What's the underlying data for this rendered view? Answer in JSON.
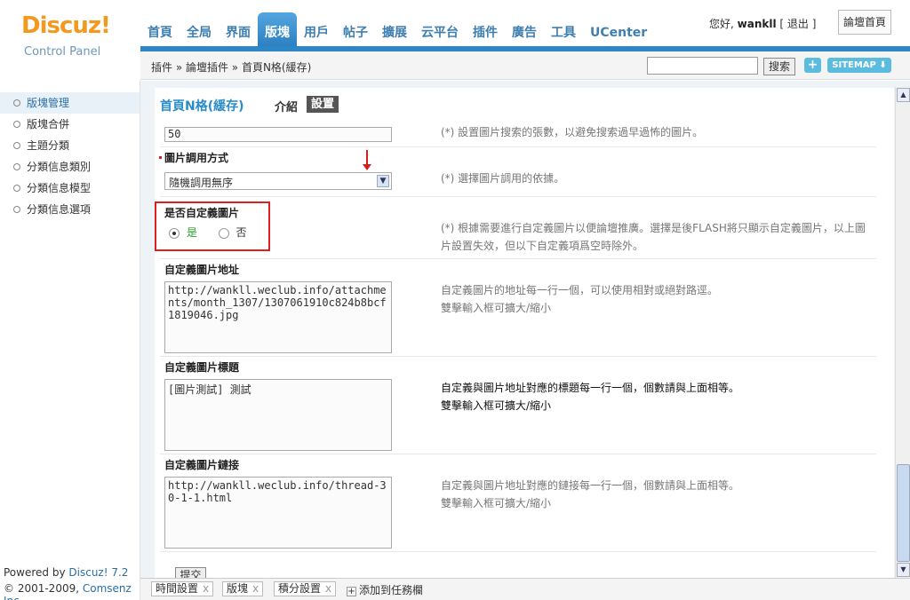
{
  "header": {
    "logo_brand": "Discuz!",
    "logo_sub": "Control Panel",
    "nav": [
      "首頁",
      "全局",
      "界面",
      "版塊",
      "用戶",
      "帖子",
      "擴展",
      "云平台",
      "插件",
      "廣告",
      "工具",
      "UCenter"
    ],
    "active_nav": "版塊",
    "greeting": "您好,",
    "username": "wankll",
    "logout": "[ 退出 ]",
    "forum_home": "論壇首頁"
  },
  "breadcrumb": "插件 » 論壇插件 » 首頁N格(緩存)",
  "search": {
    "button": "搜索",
    "placeholder": ""
  },
  "toolbar": {
    "plus": "+",
    "sitemap": "SITEMAP ⬇"
  },
  "sidebar": {
    "items": [
      "版塊管理",
      "版塊合併",
      "主題分類",
      "分類信息類別",
      "分類信息模型",
      "分類信息選項"
    ],
    "active": "版塊管理",
    "powered_prefix": "Powered by",
    "powered_link": "Discuz! 7.2",
    "copyright_prefix": "© 2001-2009,",
    "copyright_link": "Comsenz Inc."
  },
  "content": {
    "title": "首頁N格(緩存)",
    "tab_intro": "介紹",
    "tab_settings": "設置",
    "partial_value": "50",
    "partial_hint": "(*) 設置圖片搜索的張數，以避免搜索過早過怖的圖片。",
    "pic_method": {
      "label": "圖片調用方式",
      "value": "隨機調用無序",
      "hint": "(*) 選擇圖片調用的依據。"
    },
    "custom_pic": {
      "label": "是否自定義圖片",
      "yes": "是",
      "no": "否",
      "selected": "是",
      "hint_line1": "(*) 根據需要進行自定義圖片以便論壇推廣。選擇是後FLASH將只顯示自定義圖片，以上圖",
      "hint_line2": "片設置失效，但以下自定義項爲空時除外。"
    },
    "pic_url": {
      "label": "自定義圖片地址",
      "value": "http://wankll.weclub.info/attachments/month_1307/1307061910c824b8bcf1819046.jpg",
      "hint_line1": "自定義圖片的地址每一行一個，可以使用相對或絕對路逕。",
      "hint_line2": "雙擊輸入框可擴大/縮小"
    },
    "pic_title": {
      "label": "自定義圖片標題",
      "value": "[圖片測試] 測試",
      "hint_line1": "自定義與圖片地址對應的標題每一行一個，個數請與上面相等。",
      "hint_line2": "雙擊輸入框可擴大/縮小"
    },
    "pic_link": {
      "label": "自定義圖片鏈接",
      "value": "http://wankll.weclub.info/thread-30-1-1.html",
      "hint_line1": "自定義與圖片地址對應的鏈接每一行一個，個數請與上面相等。",
      "hint_line2": "雙擊輸入框可擴大/縮小"
    },
    "submit": "提交"
  },
  "taskbar": {
    "tasks": [
      "時間設置",
      "版塊",
      "積分設置"
    ],
    "close": "x",
    "add": "添加到任務欄"
  }
}
